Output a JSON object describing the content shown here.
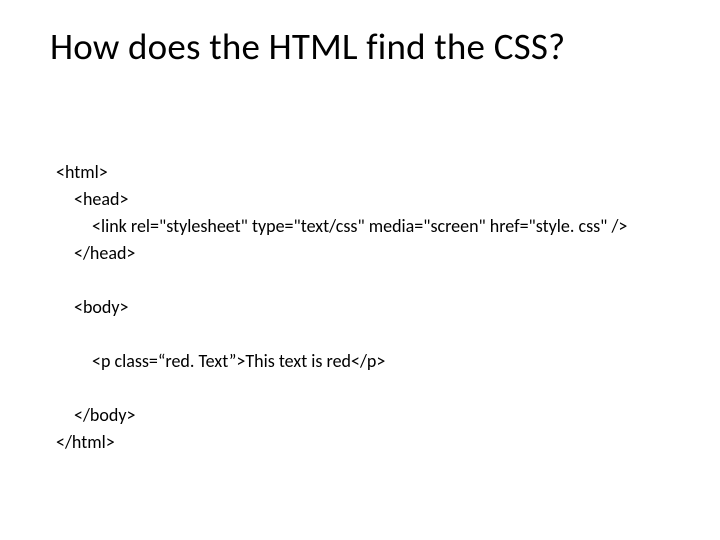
{
  "title": "How does the HTML find the CSS?",
  "code": {
    "l1": "<html>",
    "l2": "<head>",
    "l3": "<link rel=\"stylesheet\" type=\"text/css\" media=\"screen\" href=\"style. css\" />",
    "l4": "</head>",
    "l5": "<body>",
    "l6": "<p class=“red. Text”>This text is red</p>",
    "l7": "</body>",
    "l8": "</html>"
  }
}
